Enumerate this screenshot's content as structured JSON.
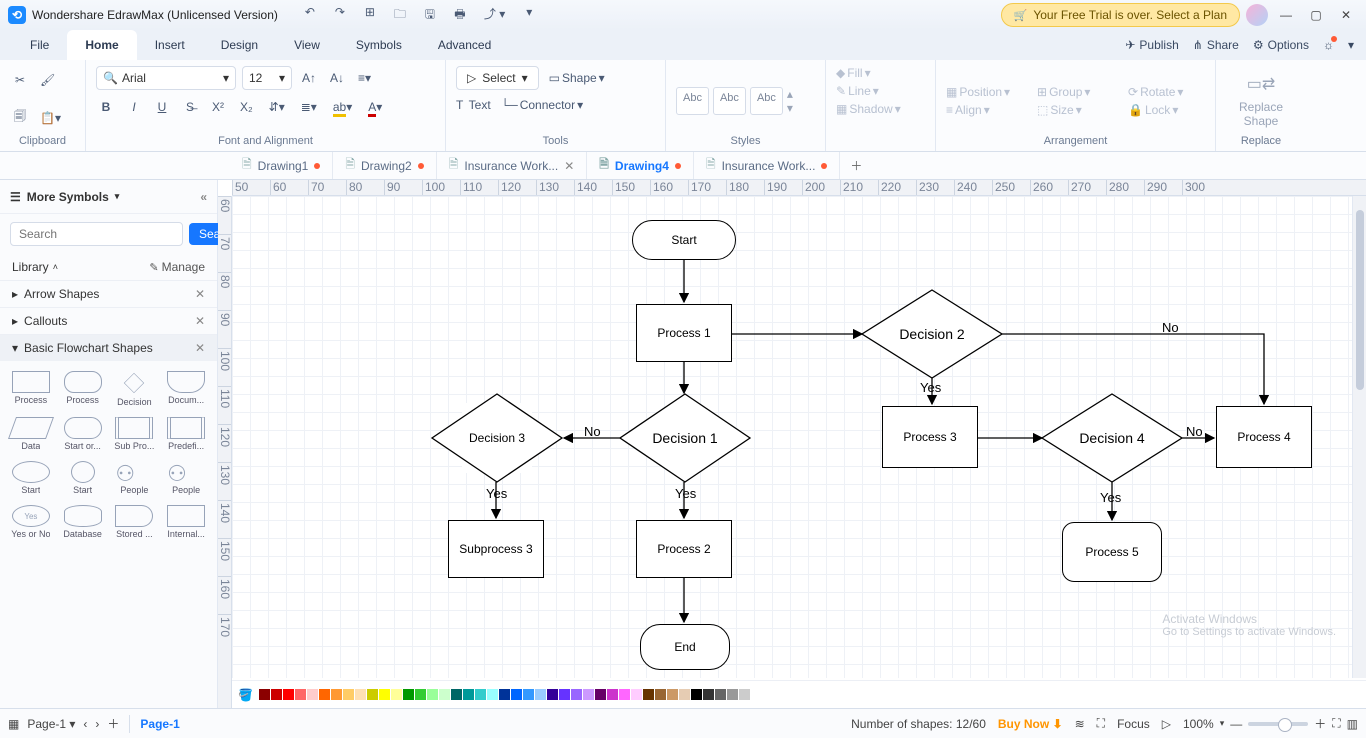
{
  "title": "Wondershare EdrawMax (Unlicensed Version)",
  "trial": "Your Free Trial is over. Select a Plan",
  "menu": {
    "file": "File",
    "home": "Home",
    "insert": "Insert",
    "design": "Design",
    "view": "View",
    "symbols": "Symbols",
    "advanced": "Advanced",
    "publish": "Publish",
    "share": "Share",
    "options": "Options"
  },
  "ribbon": {
    "clipboard": "Clipboard",
    "font": "Font and Alignment",
    "tools": "Tools",
    "styles": "Styles",
    "arrangement": "Arrangement",
    "replace": "Replace",
    "fontname": "Arial",
    "fontsize": "12",
    "select": "Select",
    "shape": "Shape",
    "text": "Text",
    "connector": "Connector",
    "abc": "Abc",
    "fill": "Fill",
    "line": "Line",
    "shadow": "Shadow",
    "position": "Position",
    "align": "Align",
    "group": "Group",
    "size": "Size",
    "rotate": "Rotate",
    "lock": "Lock",
    "replaceShape": "Replace\nShape"
  },
  "tabs": [
    {
      "name": "Drawing1",
      "dirty": true
    },
    {
      "name": "Drawing2",
      "dirty": true
    },
    {
      "name": "Insurance Work...",
      "close": true
    },
    {
      "name": "Drawing4",
      "dirty": true,
      "active": true
    },
    {
      "name": "Insurance Work...",
      "dirty": true
    }
  ],
  "sidebar": {
    "more": "More Symbols",
    "searchPlaceholder": "Search",
    "searchBtn": "Search",
    "library": "Library",
    "manage": "Manage",
    "cats": [
      "Arrow Shapes",
      "Callouts",
      "Basic Flowchart Shapes"
    ],
    "shapes": [
      "Process",
      "Process",
      "Decision",
      "Docum...",
      "Data",
      "Start or...",
      "Sub Pro...",
      "Predefi...",
      "Start",
      "Start",
      "People",
      "People",
      "Yes or No",
      "Database",
      "Stored ...",
      "Internal..."
    ]
  },
  "ruler_h": [
    "50",
    "60",
    "70",
    "80",
    "90",
    "100",
    "110",
    "120",
    "130",
    "140",
    "150",
    "160",
    "170",
    "180",
    "190",
    "200",
    "210",
    "220",
    "230",
    "240",
    "250",
    "260",
    "270",
    "280",
    "290",
    "300"
  ],
  "ruler_v": [
    "60",
    "70",
    "80",
    "90",
    "100",
    "110",
    "120",
    "130",
    "140",
    "150",
    "160",
    "170"
  ],
  "flow": {
    "start": "Start",
    "p1": "Process 1",
    "d1": "Decision 1",
    "d2": "Decision 2",
    "d3": "Decision 3",
    "d4": "Decision 4",
    "p2": "Process 2",
    "p3": "Process 3",
    "p4": "Process 4",
    "p5": "Process 5",
    "sub3": "Subprocess 3",
    "end": "End",
    "yes": "Yes",
    "no": "No"
  },
  "palette": [
    "#8b0000",
    "#cc0000",
    "#ff0000",
    "#ff6666",
    "#ffcccc",
    "#ff6600",
    "#ff9933",
    "#ffcc66",
    "#ffe0b3",
    "#cccc00",
    "#ffff00",
    "#ffff99",
    "#009900",
    "#33cc33",
    "#99ff99",
    "#ccffcc",
    "#006666",
    "#009999",
    "#33cccc",
    "#99ffff",
    "#003399",
    "#0066ff",
    "#3399ff",
    "#99ccff",
    "#330099",
    "#6633ff",
    "#9966ff",
    "#cc99ff",
    "#660066",
    "#cc33cc",
    "#ff66ff",
    "#ffccff",
    "#663300",
    "#996633",
    "#cc9966",
    "#e6ccb3",
    "#000000",
    "#333333",
    "#666666",
    "#999999",
    "#cccccc",
    "#ffffff"
  ],
  "status": {
    "page": "Page-1",
    "sheet": "Page-1",
    "shapes": "Number of shapes: 12/60",
    "buy": "Buy Now",
    "focus": "Focus",
    "zoom": "100%",
    "watermark": "Activate Windows",
    "watermark2": "Go to Settings to activate Windows."
  }
}
